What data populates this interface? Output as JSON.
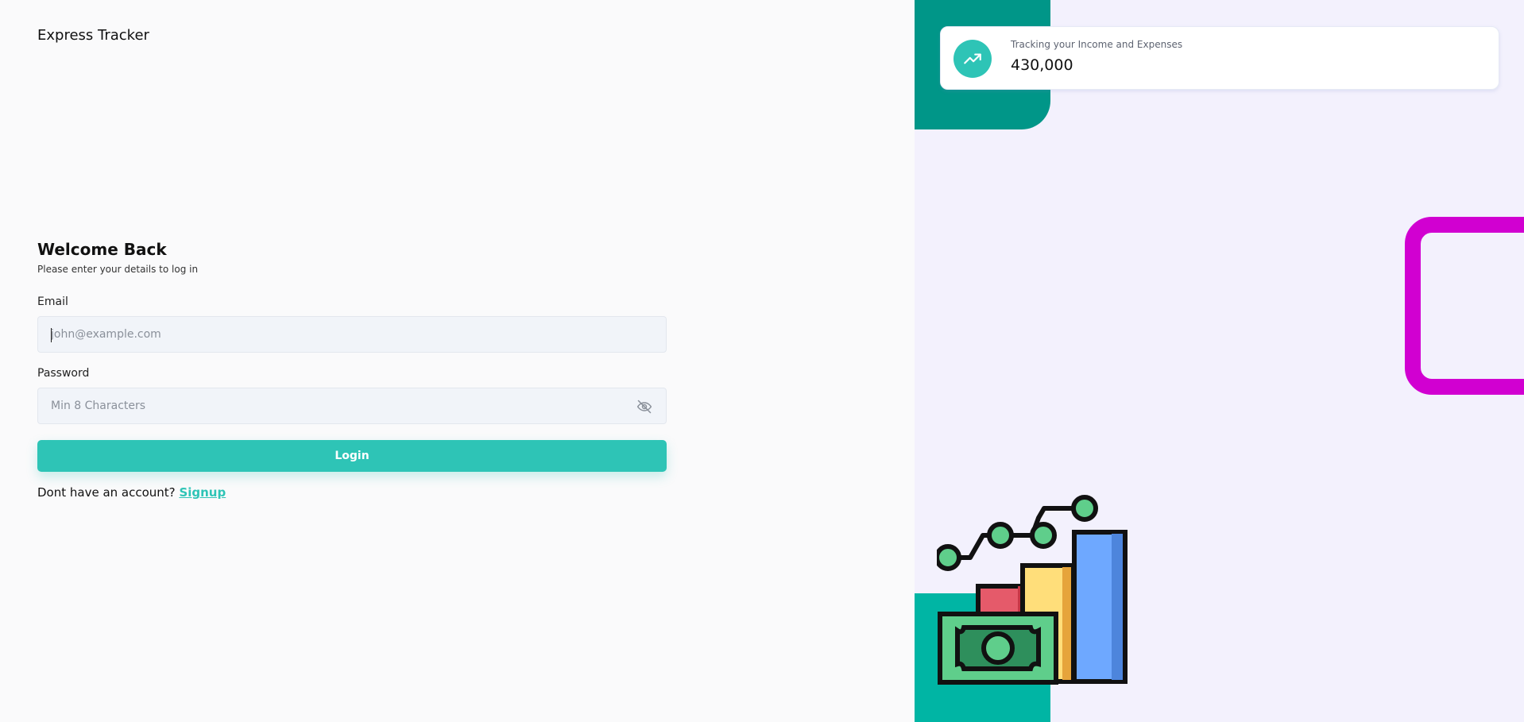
{
  "app": {
    "brand": "Express Tracker"
  },
  "login": {
    "title": "Welcome Back",
    "subtitle": "Please enter your details to log in",
    "email_label": "Email",
    "email_placeholder": "john@example.com",
    "password_label": "Password",
    "password_placeholder": "Min 8 Characters",
    "login_button": "Login",
    "signup_prompt": "Dont have an account?",
    "signup_link": "Signup"
  },
  "stats_card": {
    "caption": "Tracking your Income and Expenses",
    "value": "430,000",
    "icon": "trending-up-icon"
  },
  "colors": {
    "accent": "#2ec4b6",
    "teal_dark": "#009688",
    "teal_light": "#00b5a4",
    "magenta": "#d100d1",
    "right_panel_bg": "#f3f1fd"
  }
}
